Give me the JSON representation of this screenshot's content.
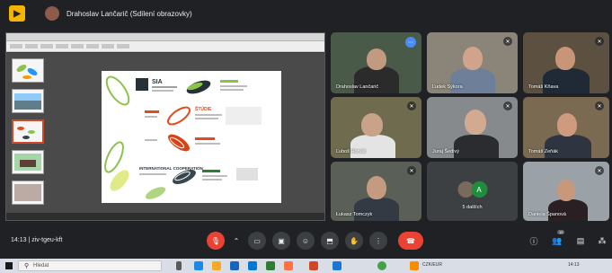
{
  "topbar": {
    "app_icon": "meet-logo-icon",
    "presenter_title": "Drahoslav Lančarič (Sdílení obrazovky)"
  },
  "presentation": {
    "slide_headings": [
      "SIA",
      "ŠTÚDIE",
      "INTERNATIONAL COOPERATION"
    ]
  },
  "participants": [
    {
      "name": "Drahoslav Lančarič",
      "speaking": true
    },
    {
      "name": "Ľudek Sýkora",
      "speaking": false
    },
    {
      "name": "Tomáš Kňava",
      "speaking": false
    },
    {
      "name": "Ľuboš Horvát",
      "speaking": false
    },
    {
      "name": "Juraj Šedivý",
      "speaking": false
    },
    {
      "name": "Tomáš Zeňák",
      "speaking": false
    },
    {
      "name": "Łukasz Tomczyk",
      "speaking": false
    },
    {
      "name": "5 dalších",
      "initial": "A",
      "speaking": false
    },
    {
      "name": "Daniela Španová",
      "speaking": false
    }
  ],
  "controls": {
    "time": "14:13",
    "meeting_code": "ziv-tgeu-kft",
    "buttons": [
      "mic-off-icon",
      "camera-icon",
      "captions-icon",
      "emoji-icon",
      "present-icon",
      "hand-icon",
      "more-icon",
      "end-call-icon"
    ],
    "right_icons": [
      "info-icon",
      "people-icon",
      "chat-icon",
      "activities-icon"
    ],
    "people_count": "10"
  },
  "taskbar": {
    "search_placeholder": "Hledat",
    "weather": "CZK/EUR",
    "clock": "14:13"
  }
}
